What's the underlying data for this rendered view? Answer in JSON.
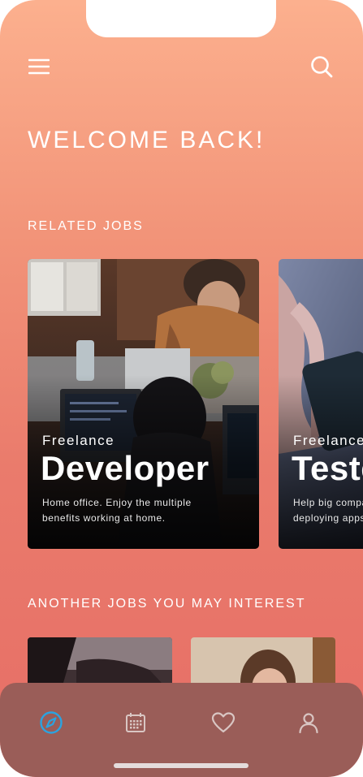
{
  "header": {
    "menu_icon": "hamburger-menu-icon",
    "search_icon": "search-icon"
  },
  "welcome": "WELCOME BACK!",
  "related": {
    "title": "RELATED JOBS",
    "cards": [
      {
        "kicker": "Freelance",
        "role": "Developer",
        "description": "Home office. Enjoy the multiple\nbenefits working at home."
      },
      {
        "kicker": "Freelance",
        "role": "Tester",
        "description": "Help big companies\ndeploying apps."
      }
    ]
  },
  "another": {
    "title": "ANOTHER JOBS YOU MAY INTEREST"
  },
  "tabbar": {
    "tabs": [
      {
        "icon": "compass-icon",
        "active": true
      },
      {
        "icon": "calendar-icon",
        "active": false
      },
      {
        "icon": "heart-icon",
        "active": false
      },
      {
        "icon": "profile-icon",
        "active": false
      }
    ],
    "active_color": "#2ba3e0"
  },
  "colors": {
    "gradient_top": "#fcb08e",
    "gradient_bottom": "#e66e66",
    "tabbar_bg": "#9a5d58"
  }
}
